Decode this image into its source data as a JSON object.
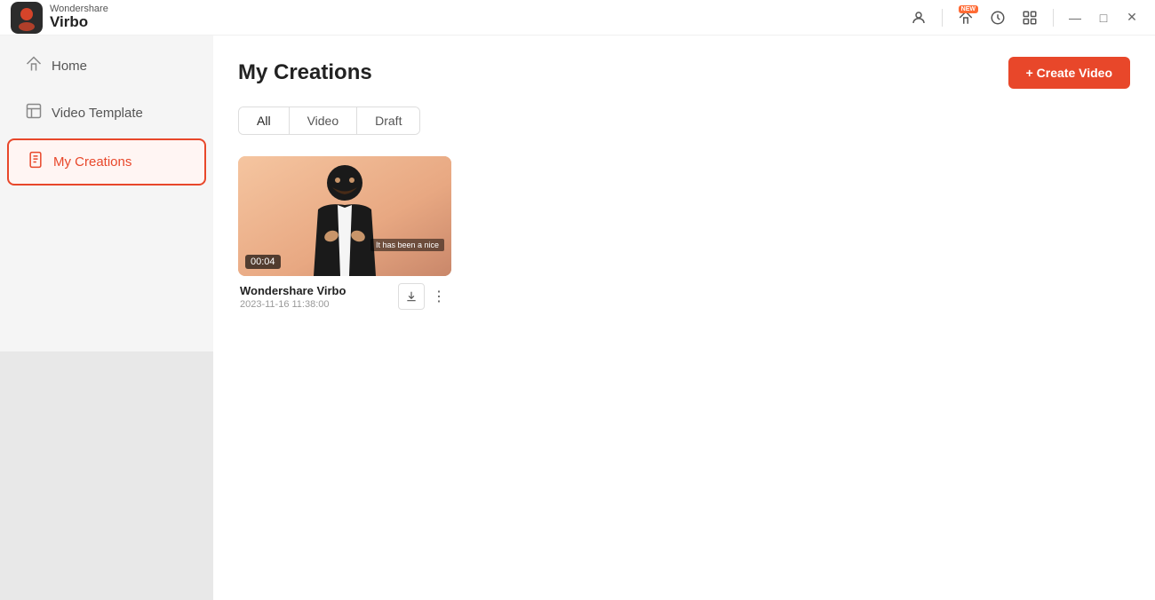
{
  "app": {
    "name_top": "Wondershare",
    "name_bottom": "Virbo"
  },
  "titlebar": {
    "icons": {
      "user": "👤",
      "home": "🏠",
      "history": "🕐",
      "apps": "⊞",
      "new_badge": "NEW"
    },
    "window_controls": {
      "minimize": "—",
      "maximize": "□",
      "close": "✕"
    }
  },
  "sidebar": {
    "items": [
      {
        "id": "home",
        "label": "Home",
        "icon": "home"
      },
      {
        "id": "video-template",
        "label": "Video Template",
        "icon": "template"
      },
      {
        "id": "my-creations",
        "label": "My Creations",
        "icon": "creations"
      }
    ]
  },
  "page": {
    "title": "My Creations",
    "create_button": "+ Create Video"
  },
  "tabs": [
    {
      "id": "all",
      "label": "All",
      "active": true
    },
    {
      "id": "video",
      "label": "Video",
      "active": false
    },
    {
      "id": "draft",
      "label": "Draft",
      "active": false
    }
  ],
  "videos": [
    {
      "id": "v1",
      "title": "Wondershare Virbo",
      "date": "2023-11-16 11:38:00",
      "duration": "00:04",
      "subtitle_text": "It has been a nice"
    }
  ]
}
